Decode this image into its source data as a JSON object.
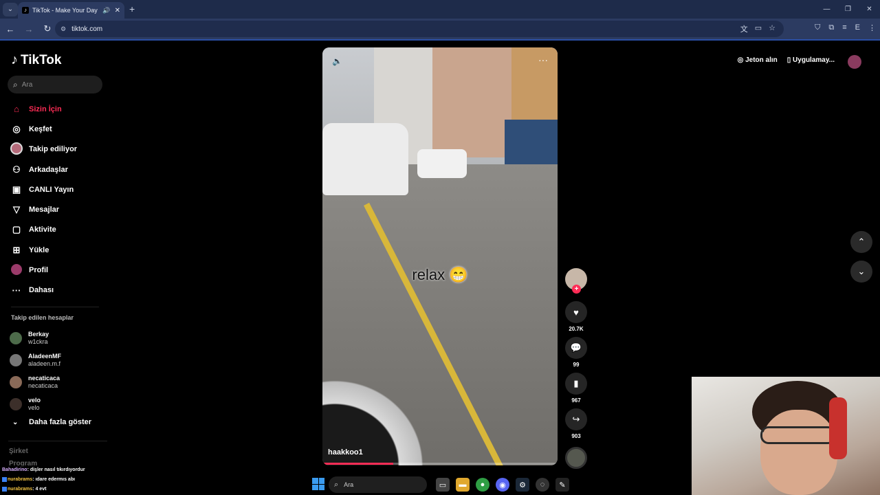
{
  "browser": {
    "tab_title": "TikTok - Make Your Day",
    "url": "tiktok.com"
  },
  "sidebar": {
    "brand": "TikTok",
    "search_placeholder": "Ara",
    "nav": [
      {
        "label": "Sizin İçin",
        "icon": "home-icon"
      },
      {
        "label": "Keşfet",
        "icon": "compass-icon"
      },
      {
        "label": "Takip ediliyor",
        "icon": "following-avatar"
      },
      {
        "label": "Arkadaşlar",
        "icon": "friends-icon"
      },
      {
        "label": "CANLI Yayın",
        "icon": "live-icon"
      },
      {
        "label": "Mesajlar",
        "icon": "messages-icon"
      },
      {
        "label": "Aktivite",
        "icon": "activity-icon"
      },
      {
        "label": "Yükle",
        "icon": "upload-icon"
      },
      {
        "label": "Profil",
        "icon": "profile-avatar"
      },
      {
        "label": "Dahası",
        "icon": "more-icon"
      }
    ],
    "following_title": "Takip edilen hesaplar",
    "following": [
      {
        "name": "Berkay",
        "user": "w1ckra"
      },
      {
        "name": "AladeenMF",
        "user": "aladeen.m.f"
      },
      {
        "name": "necaticaca",
        "user": "necaticaca"
      },
      {
        "name": "velo",
        "user": "velo"
      }
    ],
    "show_more": "Daha fazla göster",
    "footer": [
      "Şirket",
      "Program"
    ]
  },
  "video": {
    "caption": "relax 😁",
    "username": "haakkoo1",
    "progress": 0.3
  },
  "actions": {
    "likes": "20.7K",
    "comments": "99",
    "saves": "967",
    "shares": "903"
  },
  "header_right": {
    "coins": "Jeton alın",
    "app": "Uygulamay..."
  },
  "chat": [
    {
      "user": "Bahadirino",
      "text": ": dişler nasıl tıkırdıyordur"
    },
    {
      "user": "nurabrams",
      "text": ": ıdare edermıs abı"
    },
    {
      "user": "nurabrams",
      "text": ": 4 evt"
    }
  ],
  "taskbar": {
    "search_placeholder": "Ara"
  }
}
